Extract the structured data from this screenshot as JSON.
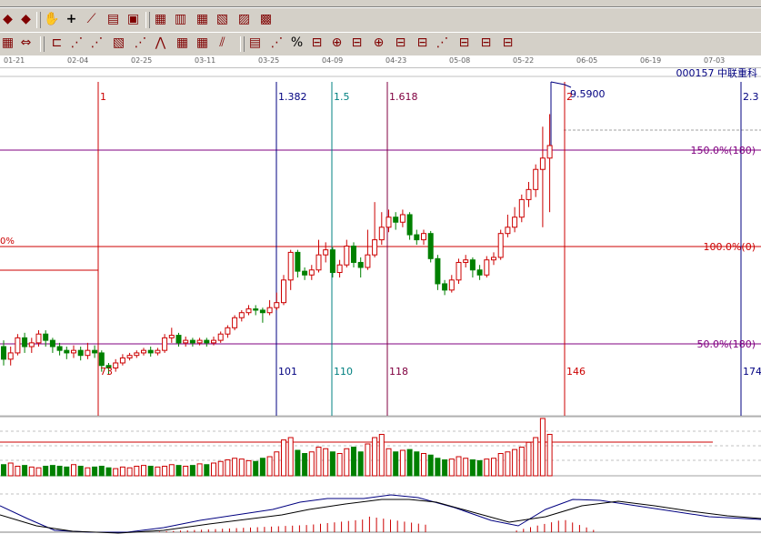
{
  "toolbar": {
    "row1_icons": [
      "nav-left-icon",
      "nav-right-icon",
      "hand-pan-icon",
      "crosshair-icon",
      "line-tool-icon",
      "stock-list-icon",
      "window-icon",
      "calendar-icon",
      "calculator-icon",
      "table-icon",
      "save-icon",
      "print-icon",
      "car-icon"
    ],
    "row2_icons": [
      "grid-icon",
      "resize-icon",
      "bar-select-icon",
      "fan-line-icon",
      "angle-icon",
      "box-icon",
      "trend-icon",
      "wave-icon",
      "grid-box-icon",
      "grid-box-2-icon",
      "parallel-icon",
      "text-table-icon",
      "fibonacci-icon",
      "percent-icon",
      "speed-line-icon",
      "gann-icon",
      "channel-icon",
      "fib-arc-icon",
      "fib-fan-icon",
      "fib-time-icon",
      "gann-fan-icon",
      "regression-icon",
      "fib-extension-icon",
      "cycle-icon"
    ],
    "row2_percent": "%"
  },
  "dates": [
    "01-21",
    "02-04",
    "02-25",
    "03-11",
    "03-25",
    "04-09",
    "04-23",
    "05-08",
    "05-22",
    "06-05",
    "06-19",
    "07-03"
  ],
  "stock": {
    "code": "000157",
    "name": "中联重科"
  },
  "fibonacci_time": {
    "lines": [
      {
        "top": "1",
        "bottom": "73",
        "color": "#cc0000"
      },
      {
        "top": "1.382",
        "bottom": "101",
        "color": "#000080"
      },
      {
        "top": "1.5",
        "bottom": "110",
        "color": "#008080"
      },
      {
        "top": "1.618",
        "bottom": "118",
        "color": "#800040"
      },
      {
        "top": "2",
        "bottom": "146",
        "color": "#cc0000"
      },
      {
        "top": "2.3",
        "bottom": "174",
        "color": "#000080"
      }
    ]
  },
  "price_label": "9.5900",
  "levels": [
    {
      "label": "150.0%(180)",
      "color": "#800080"
    },
    {
      "label": "100.0%(0)",
      "color": "#cc0000"
    },
    {
      "label": "50.0%(180)",
      "color": "#800080"
    }
  ],
  "left_cut_label": "0%",
  "chart_data": {
    "type": "candlestick",
    "ylim": [
      7.0,
      9.7
    ],
    "candles": [
      [
        7.55,
        7.45,
        7.6,
        7.4
      ],
      [
        7.45,
        7.5,
        7.55,
        7.4
      ],
      [
        7.5,
        7.62,
        7.65,
        7.48
      ],
      [
        7.62,
        7.55,
        7.66,
        7.5
      ],
      [
        7.55,
        7.58,
        7.62,
        7.5
      ],
      [
        7.58,
        7.65,
        7.68,
        7.55
      ],
      [
        7.65,
        7.6,
        7.68,
        7.55
      ],
      [
        7.6,
        7.55,
        7.62,
        7.5
      ],
      [
        7.55,
        7.52,
        7.58,
        7.48
      ],
      [
        7.52,
        7.5,
        7.55,
        7.45
      ],
      [
        7.5,
        7.52,
        7.56,
        7.46
      ],
      [
        7.52,
        7.48,
        7.55,
        7.44
      ],
      [
        7.48,
        7.52,
        7.58,
        7.45
      ],
      [
        7.52,
        7.5,
        7.56,
        7.46
      ],
      [
        7.5,
        7.4,
        7.52,
        7.35
      ],
      [
        7.4,
        7.38,
        7.42,
        7.33
      ],
      [
        7.38,
        7.42,
        7.45,
        7.35
      ],
      [
        7.42,
        7.46,
        7.49,
        7.4
      ],
      [
        7.46,
        7.48,
        7.5,
        7.44
      ],
      [
        7.48,
        7.5,
        7.52,
        7.46
      ],
      [
        7.5,
        7.52,
        7.54,
        7.48
      ],
      [
        7.52,
        7.5,
        7.55,
        7.47
      ],
      [
        7.5,
        7.52,
        7.54,
        7.48
      ],
      [
        7.52,
        7.62,
        7.65,
        7.5
      ],
      [
        7.62,
        7.64,
        7.7,
        7.58
      ],
      [
        7.64,
        7.58,
        7.66,
        7.55
      ],
      [
        7.58,
        7.6,
        7.63,
        7.55
      ],
      [
        7.6,
        7.58,
        7.62,
        7.55
      ],
      [
        7.58,
        7.6,
        7.62,
        7.56
      ],
      [
        7.6,
        7.58,
        7.62,
        7.55
      ],
      [
        7.58,
        7.6,
        7.63,
        7.56
      ],
      [
        7.6,
        7.65,
        7.67,
        7.58
      ],
      [
        7.65,
        7.7,
        7.72,
        7.62
      ],
      [
        7.7,
        7.78,
        7.8,
        7.68
      ],
      [
        7.78,
        7.82,
        7.84,
        7.75
      ],
      [
        7.82,
        7.85,
        7.88,
        7.8
      ],
      [
        7.85,
        7.84,
        7.88,
        7.8
      ],
      [
        7.84,
        7.82,
        7.86,
        7.74
      ],
      [
        7.82,
        7.86,
        7.92,
        7.8
      ],
      [
        7.86,
        7.9,
        7.98,
        7.84
      ],
      [
        7.9,
        8.08,
        8.12,
        7.88
      ],
      [
        8.08,
        8.3,
        8.32,
        8.0
      ],
      [
        8.3,
        8.15,
        8.32,
        8.1
      ],
      [
        8.15,
        8.12,
        8.18,
        8.08
      ],
      [
        8.12,
        8.16,
        8.2,
        8.08
      ],
      [
        8.16,
        8.28,
        8.4,
        8.14
      ],
      [
        8.28,
        8.32,
        8.38,
        8.22
      ],
      [
        8.32,
        8.14,
        8.34,
        8.1
      ],
      [
        8.14,
        8.2,
        8.24,
        8.1
      ],
      [
        8.2,
        8.35,
        8.4,
        8.18
      ],
      [
        8.35,
        8.22,
        8.38,
        8.18
      ],
      [
        8.22,
        8.18,
        8.26,
        8.1
      ],
      [
        8.18,
        8.28,
        8.48,
        8.16
      ],
      [
        8.28,
        8.4,
        8.7,
        8.26
      ],
      [
        8.4,
        8.5,
        8.62,
        8.36
      ],
      [
        8.5,
        8.58,
        8.64,
        8.46
      ],
      [
        8.58,
        8.54,
        8.62,
        8.48
      ],
      [
        8.54,
        8.6,
        8.64,
        8.5
      ],
      [
        8.6,
        8.44,
        8.62,
        8.4
      ],
      [
        8.44,
        8.4,
        8.48,
        8.36
      ],
      [
        8.4,
        8.45,
        8.48,
        8.36
      ],
      [
        8.45,
        8.25,
        8.47,
        8.22
      ],
      [
        8.25,
        8.05,
        8.28,
        8.0
      ],
      [
        8.05,
        8.0,
        8.08,
        7.96
      ],
      [
        8.0,
        8.08,
        8.12,
        7.98
      ],
      [
        8.08,
        8.22,
        8.25,
        8.05
      ],
      [
        8.22,
        8.24,
        8.28,
        8.18
      ],
      [
        8.24,
        8.16,
        8.26,
        8.1
      ],
      [
        8.16,
        8.12,
        8.2,
        8.08
      ],
      [
        8.12,
        8.24,
        8.27,
        8.1
      ],
      [
        8.24,
        8.26,
        8.3,
        8.2
      ],
      [
        8.26,
        8.45,
        8.48,
        8.24
      ],
      [
        8.45,
        8.5,
        8.6,
        8.42
      ],
      [
        8.5,
        8.58,
        8.66,
        8.46
      ],
      [
        8.58,
        8.72,
        8.76,
        8.54
      ],
      [
        8.72,
        8.8,
        8.86,
        8.66
      ],
      [
        8.8,
        8.96,
        9.0,
        8.74
      ],
      [
        8.96,
        9.05,
        9.3,
        8.5
      ],
      [
        9.05,
        9.15,
        9.4,
        8.62
      ]
    ],
    "volume": [
      14,
      16,
      12,
      13,
      11,
      10,
      12,
      13,
      12,
      11,
      14,
      12,
      10,
      11,
      12,
      10,
      9,
      11,
      10,
      12,
      13,
      12,
      11,
      12,
      14,
      13,
      12,
      13,
      15,
      14,
      16,
      18,
      20,
      22,
      21,
      19,
      18,
      22,
      24,
      30,
      45,
      48,
      32,
      28,
      30,
      36,
      34,
      30,
      28,
      34,
      36,
      30,
      40,
      48,
      52,
      34,
      30,
      32,
      33,
      30,
      28,
      26,
      22,
      20,
      21,
      24,
      22,
      20,
      19,
      21,
      22,
      28,
      30,
      33,
      36,
      42,
      48,
      72,
      52
    ]
  }
}
